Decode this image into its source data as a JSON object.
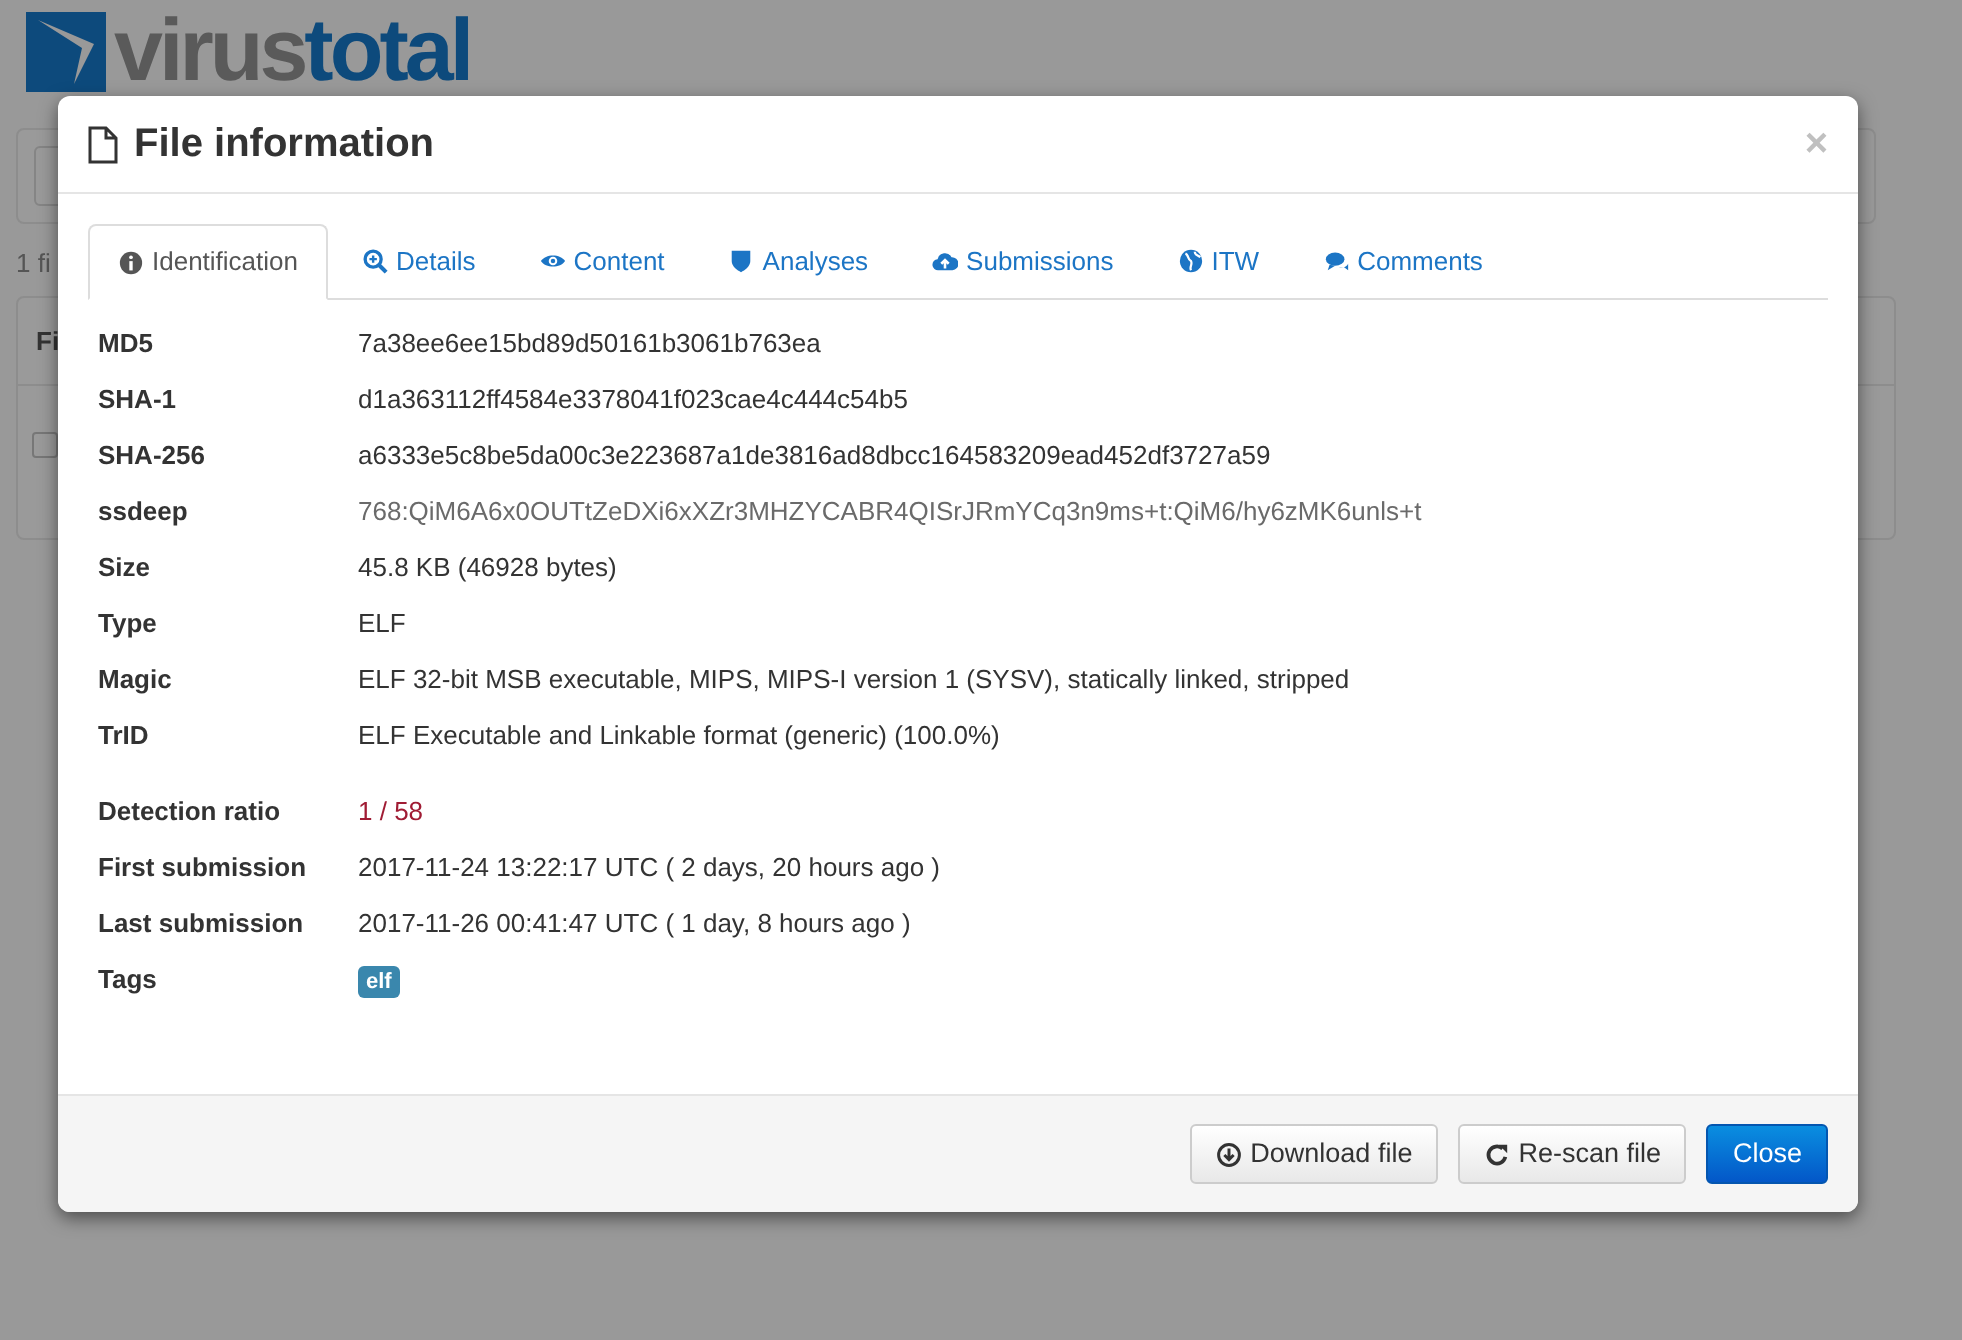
{
  "background": {
    "logo": {
      "word_1": "virus",
      "word_2": "total"
    },
    "result_count": "1 fi",
    "table_header": "Fi",
    "row_checked": false
  },
  "dialog": {
    "title": "File information",
    "close": "×",
    "tabs": [
      {
        "label": "Identification",
        "kind": "info",
        "selected": true
      },
      {
        "label": "Details",
        "kind": "search",
        "selected": false
      },
      {
        "label": "Content",
        "kind": "eye",
        "selected": false
      },
      {
        "label": "Analyses",
        "kind": "shield",
        "selected": false
      },
      {
        "label": "Submissions",
        "kind": "cloud",
        "selected": false
      },
      {
        "label": "ITW",
        "kind": "globe",
        "selected": false
      },
      {
        "label": "Comments",
        "kind": "comments",
        "selected": false
      }
    ],
    "sections": [
      [
        {
          "label": "MD5",
          "value": "7a38ee6ee15bd89d50161b3061b763ea",
          "kind": "text"
        },
        {
          "label": "SHA-1",
          "value": "d1a363112ff4584e3378041f023cae4c444c54b5",
          "kind": "text"
        },
        {
          "label": "SHA-256",
          "value": "a6333e5c8be5da00c3e223687a1de3816ad8dbcc164583209ead452df3727a59",
          "kind": "text"
        },
        {
          "label": "ssdeep",
          "value": "768:QiM6A6x0OUTtZeDXi6xXZr3MHZYCABR4QISrJRmYCq3n9ms+t:QiM6/hy6zMK6unls+t",
          "kind": "muted"
        },
        {
          "label": "Size",
          "value": "45.8 KB (46928 bytes)",
          "kind": "text"
        },
        {
          "label": "Type",
          "value": "ELF",
          "kind": "text"
        },
        {
          "label": "Magic",
          "value": "ELF 32-bit MSB executable, MIPS, MIPS-I version 1 (SYSV), statically linked, stripped",
          "kind": "text"
        },
        {
          "label": "TrID",
          "value": "ELF Executable and Linkable format (generic) (100.0%)",
          "kind": "text"
        }
      ],
      [
        {
          "label": "Detection ratio",
          "value": "1 / 58",
          "kind": "ratio"
        },
        {
          "label": "First submission",
          "value": "2017-11-24 13:22:17 UTC ( 2 days, 20 hours ago )",
          "kind": "text"
        },
        {
          "label": "Last submission",
          "value": "2017-11-26 00:41:47 UTC ( 1 day, 8 hours ago )",
          "kind": "text"
        },
        {
          "label": "Tags",
          "value": "elf",
          "kind": "tag"
        }
      ]
    ],
    "buttons": [
      {
        "label": "Download file",
        "kind": "download"
      },
      {
        "label": "Re-scan file",
        "kind": "refresh"
      },
      {
        "label": "Close",
        "kind": "close"
      }
    ]
  }
}
